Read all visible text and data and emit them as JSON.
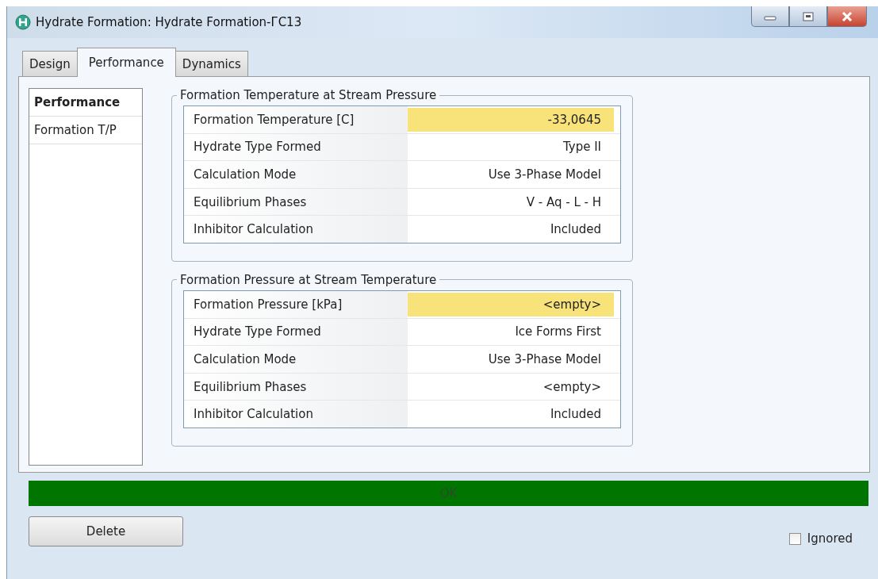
{
  "window": {
    "title": "Hydrate Formation: Hydrate Formation-ГС13"
  },
  "tabs": [
    {
      "label": "Design",
      "selected": false
    },
    {
      "label": "Performance",
      "selected": true
    },
    {
      "label": "Dynamics",
      "selected": false
    }
  ],
  "sidebar": {
    "items": [
      {
        "label": "Performance",
        "selected": true
      },
      {
        "label": "Formation T/P",
        "selected": false
      }
    ]
  },
  "groups": [
    {
      "title": "Formation Temperature at Stream Pressure",
      "rows": [
        {
          "label": "Formation Temperature [C]",
          "value": "-33,0645",
          "highlighted": true
        },
        {
          "label": "Hydrate Type Formed",
          "value": "Type II",
          "highlighted": false
        },
        {
          "label": "Calculation Mode",
          "value": "Use 3-Phase Model",
          "highlighted": false
        },
        {
          "label": "Equilibrium Phases",
          "value": "V - Aq - L - H",
          "highlighted": false
        },
        {
          "label": "Inhibitor Calculation",
          "value": "Included",
          "highlighted": false
        }
      ]
    },
    {
      "title": "Formation Pressure at Stream Temperature",
      "rows": [
        {
          "label": "Formation Pressure [kPa]",
          "value": "<empty>",
          "highlighted": true
        },
        {
          "label": "Hydrate Type Formed",
          "value": "Ice Forms First",
          "highlighted": false
        },
        {
          "label": "Calculation Mode",
          "value": "Use 3-Phase Model",
          "highlighted": false
        },
        {
          "label": "Equilibrium Phases",
          "value": "<empty>",
          "highlighted": false
        },
        {
          "label": "Inhibitor Calculation",
          "value": "Included",
          "highlighted": false
        }
      ]
    }
  ],
  "status_bar": {
    "text": "OK"
  },
  "buttons": [
    {
      "label": "Delete"
    }
  ],
  "ignored": {
    "label": "Ignored",
    "checked": false
  }
}
